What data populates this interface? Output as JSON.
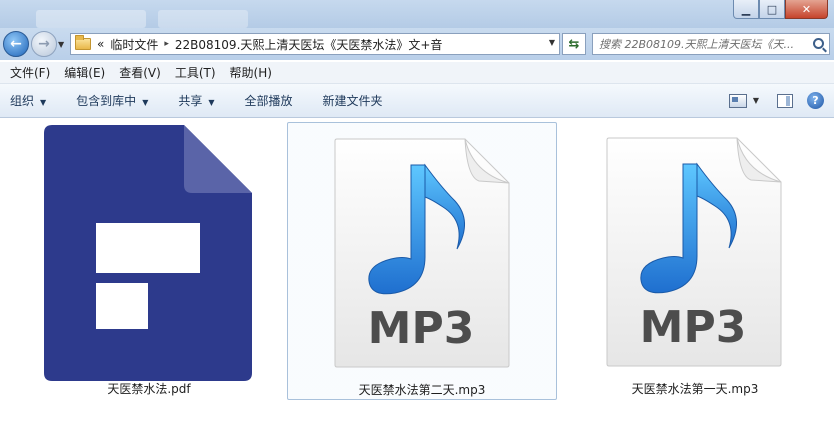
{
  "window": {
    "buttons": {
      "minimize": "▁",
      "maximize": "□",
      "close": "✕"
    }
  },
  "nav": {
    "back_glyph": "←",
    "forward_glyph": "→",
    "address": {
      "overflow": "«",
      "crumbs": [
        "临时文件",
        "22B08109.天熙上清天医坛《天医禁水法》文+音"
      ],
      "separator": "▸"
    },
    "search": {
      "placeholder": "搜索 22B08109.天熙上清天医坛《天..."
    }
  },
  "menu": {
    "items": [
      "文件(F)",
      "编辑(E)",
      "查看(V)",
      "工具(T)",
      "帮助(H)"
    ]
  },
  "toolbar": {
    "organize": "组织",
    "include_library": "包含到库中",
    "share": "共享",
    "play_all": "全部播放",
    "new_folder": "新建文件夹",
    "help_glyph": "?"
  },
  "files": [
    {
      "name": "天医禁水法.pdf",
      "type": "pdf"
    },
    {
      "name": "天医禁水法第二天.mp3",
      "type": "mp3",
      "selected": true
    },
    {
      "name": "天医禁水法第一天.mp3",
      "type": "mp3"
    }
  ],
  "icons": {
    "mp3_text": "MP3"
  },
  "colors": {
    "pdf_blue": "#2d3a8c",
    "pdf_fold": "#5a64a8",
    "note_blue": "#1f8de0"
  }
}
